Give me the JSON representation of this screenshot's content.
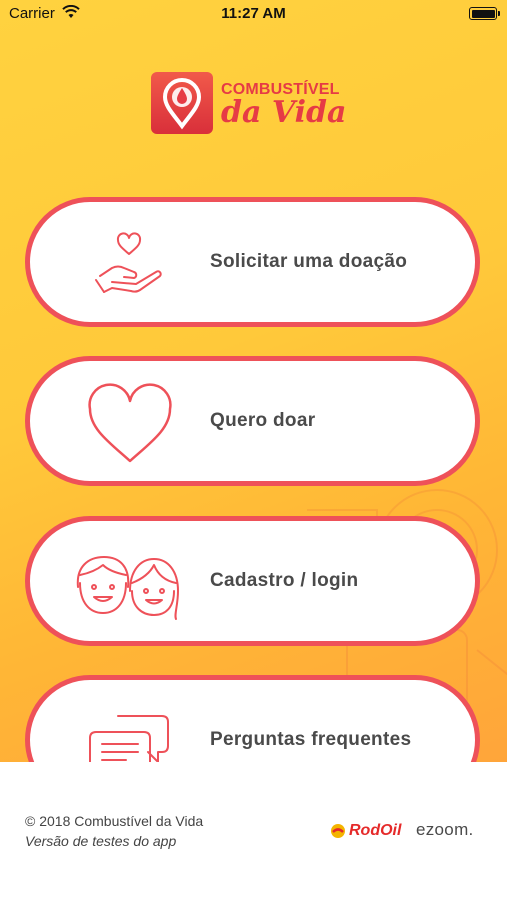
{
  "status_bar": {
    "carrier": "Carrier",
    "time": "11:27 AM"
  },
  "app": {
    "logo_title": "COMBUSTÍVEL",
    "logo_subtitle": "da Vida",
    "brand_color": "#e63b45",
    "background_color": "#ffc93a"
  },
  "menu": {
    "request_donation": "Solicitar uma doação",
    "donate": "Quero doar",
    "register_login": "Cadastro / login",
    "faq": "Perguntas frequentes"
  },
  "icons": {
    "request_donation": "heart-in-hand-icon",
    "donate": "heart-icon",
    "register_login": "couple-faces-icon",
    "faq": "chat-bubbles-icon"
  },
  "footer": {
    "copyright": "© 2018 Combustível da Vida",
    "version": "Versão de testes do app",
    "partner1": "RodOil",
    "partner2": "ezoom."
  }
}
